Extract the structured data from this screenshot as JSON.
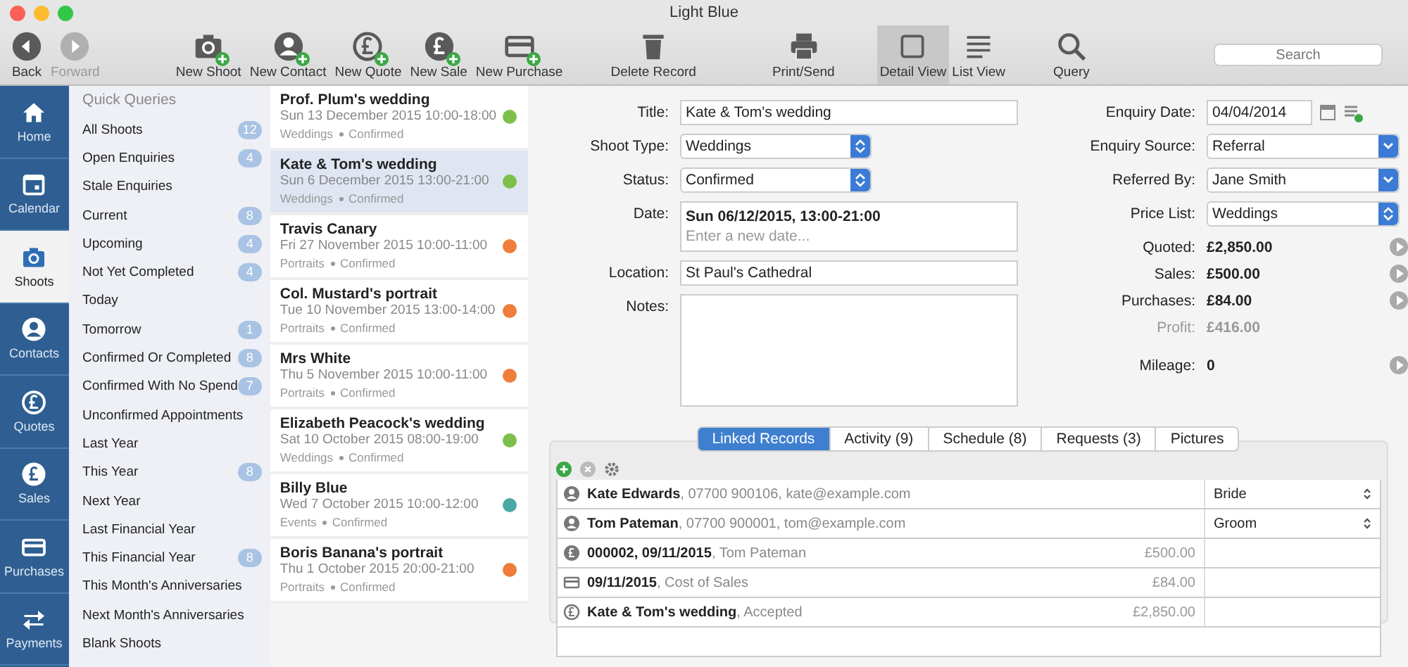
{
  "window": {
    "title": "Light Blue"
  },
  "toolbar": [
    {
      "kind": "back",
      "label": "Back",
      "disabled": false,
      "selected": false
    },
    {
      "kind": "forward",
      "label": "Forward",
      "disabled": true,
      "selected": false
    },
    {
      "kind": "camera",
      "label": "New Shoot",
      "disabled": false,
      "selected": false
    },
    {
      "kind": "person",
      "label": "New Contact",
      "disabled": false,
      "selected": false
    },
    {
      "kind": "quote",
      "label": "New Quote",
      "disabled": false,
      "selected": false
    },
    {
      "kind": "sale",
      "label": "New Sale",
      "disabled": false,
      "selected": false
    },
    {
      "kind": "card",
      "label": "New Purchase",
      "disabled": false,
      "selected": false
    },
    {
      "kind": "trash",
      "label": "Delete Record",
      "disabled": false,
      "selected": false
    },
    {
      "kind": "printer",
      "label": "Print/Send",
      "disabled": false,
      "selected": false
    },
    {
      "kind": "square",
      "label": "Detail View",
      "disabled": false,
      "selected": true
    },
    {
      "kind": "lines",
      "label": "List View",
      "disabled": false,
      "selected": false
    },
    {
      "kind": "magnifier",
      "label": "Query",
      "disabled": false,
      "selected": false
    }
  ],
  "search": {
    "placeholder": "Search"
  },
  "nav": [
    {
      "kind": "home",
      "label": "Home",
      "selected": false
    },
    {
      "kind": "calendar",
      "label": "Calendar",
      "selected": false
    },
    {
      "kind": "camera",
      "label": "Shoots",
      "selected": true
    },
    {
      "kind": "person",
      "label": "Contacts",
      "selected": false
    },
    {
      "kind": "quote",
      "label": "Quotes",
      "selected": false
    },
    {
      "kind": "sale",
      "label": "Sales",
      "selected": false
    },
    {
      "kind": "card",
      "label": "Purchases",
      "selected": false
    },
    {
      "kind": "arrows",
      "label": "Payments",
      "selected": false
    }
  ],
  "quick_queries": {
    "title": "Quick Queries",
    "items": [
      {
        "label": "All Shoots",
        "count": "12"
      },
      {
        "label": "Open Enquiries",
        "count": "4"
      },
      {
        "label": "Stale Enquiries"
      },
      {
        "label": "Current",
        "count": "8"
      },
      {
        "label": "Upcoming",
        "count": "4"
      },
      {
        "label": "Not Yet Completed",
        "count": "4"
      },
      {
        "label": "Today"
      },
      {
        "label": "Tomorrow",
        "count": "1"
      },
      {
        "label": "Confirmed Or Completed",
        "count": "8"
      },
      {
        "label": "Confirmed With No Spend",
        "count": "7"
      },
      {
        "label": "Unconfirmed Appointments"
      },
      {
        "label": "Last Year"
      },
      {
        "label": "This Year",
        "count": "8"
      },
      {
        "label": "Next Year"
      },
      {
        "label": "Last Financial Year"
      },
      {
        "label": "This Financial Year",
        "count": "8"
      },
      {
        "label": "This Month's Anniversaries"
      },
      {
        "label": "Next Month's Anniversaries"
      },
      {
        "label": "Blank Shoots"
      }
    ]
  },
  "shoots": [
    {
      "title": "Prof. Plum's wedding",
      "date": "Sun 13 December 2015 10:00-18:00",
      "type": "Weddings",
      "status": "Confirmed",
      "color": "#7cc04b",
      "selected": false
    },
    {
      "title": "Kate & Tom's wedding",
      "date": "Sun 6 December 2015 13:00-21:00",
      "type": "Weddings",
      "status": "Confirmed",
      "color": "#7cc04b",
      "selected": true
    },
    {
      "title": "Travis Canary",
      "date": "Fri 27 November 2015 10:00-11:00",
      "type": "Portraits",
      "status": "Confirmed",
      "color": "#ef7d3c",
      "selected": false
    },
    {
      "title": "Col. Mustard's portrait",
      "date": "Tue 10 November 2015 13:00-14:00",
      "type": "Portraits",
      "status": "Confirmed",
      "color": "#ef7d3c",
      "selected": false
    },
    {
      "title": "Mrs White",
      "date": "Thu 5 November 2015 10:00-11:00",
      "type": "Portraits",
      "status": "Confirmed",
      "color": "#ef7d3c",
      "selected": false
    },
    {
      "title": "Elizabeth Peacock's wedding",
      "date": "Sat 10 October 2015 08:00-19:00",
      "type": "Weddings",
      "status": "Confirmed",
      "color": "#7cc04b",
      "selected": false
    },
    {
      "title": "Billy Blue",
      "date": "Wed 7 October 2015 10:00-12:00",
      "type": "Events",
      "status": "Confirmed",
      "color": "#4aa9a4",
      "selected": false
    },
    {
      "title": "Boris Banana's portrait",
      "date": "Thu 1 October 2015 20:00-21:00",
      "type": "Portraits",
      "status": "Confirmed",
      "color": "#ef7d3c",
      "selected": false
    }
  ],
  "detail": {
    "left": [
      {
        "kind": "text",
        "label": "Title:",
        "value": "Kate & Tom's wedding"
      },
      {
        "kind": "stepper",
        "label": "Shoot Type:",
        "value": "Weddings"
      },
      {
        "kind": "stepper",
        "label": "Status:",
        "value": "Confirmed"
      },
      {
        "kind": "date",
        "label": "Date:",
        "value": "Sun 06/12/2015, 13:00-21:00",
        "placeholder": "Enter a new date..."
      },
      {
        "kind": "text",
        "label": "Location:",
        "value": "St Paul's Cathedral"
      },
      {
        "kind": "notes",
        "label": "Notes:"
      }
    ],
    "right": [
      {
        "kind": "datefield",
        "label": "Enquiry Date:",
        "value": "04/04/2014"
      },
      {
        "kind": "dropdown",
        "label": "Enquiry Source:",
        "value": "Referral"
      },
      {
        "kind": "dropdown",
        "label": "Referred By:",
        "value": "Jane Smith"
      },
      {
        "kind": "stepper",
        "label": "Price List:",
        "value": "Weddings"
      },
      {
        "kind": "amount",
        "label": "Quoted:",
        "value": "£2,850.00"
      },
      {
        "kind": "amount",
        "label": "Sales:",
        "value": "£500.00"
      },
      {
        "kind": "amount",
        "label": "Purchases:",
        "value": "£84.00"
      },
      {
        "kind": "muted",
        "label": "Profit:",
        "value": "£416.00"
      },
      {
        "kind": "amount",
        "label": "Mileage:",
        "value": "0"
      }
    ]
  },
  "tabs": [
    {
      "label": "Linked Records",
      "selected": true
    },
    {
      "label": "Activity (9)",
      "selected": false
    },
    {
      "label": "Schedule (8)",
      "selected": false
    },
    {
      "label": "Requests (3)",
      "selected": false
    },
    {
      "label": "Pictures",
      "selected": false
    }
  ],
  "linked_records": [
    {
      "kind": "contact",
      "name": "Kate Edwards",
      "detail": ", 07700 900106, kate@example.com",
      "role": "Bride"
    },
    {
      "kind": "contact",
      "name": "Tom Pateman",
      "detail": ", 07700 900001, tom@example.com",
      "role": "Groom"
    },
    {
      "kind": "sale",
      "name": "000002, 09/11/2015",
      "detail": ", Tom Pateman",
      "amount": "£500.00"
    },
    {
      "kind": "purchase",
      "name": "09/11/2015",
      "detail": ", Cost of Sales",
      "amount": "£84.00"
    },
    {
      "kind": "quote",
      "name": "Kate & Tom's wedding",
      "detail": ", Accepted",
      "amount": "£2,850.00"
    }
  ]
}
